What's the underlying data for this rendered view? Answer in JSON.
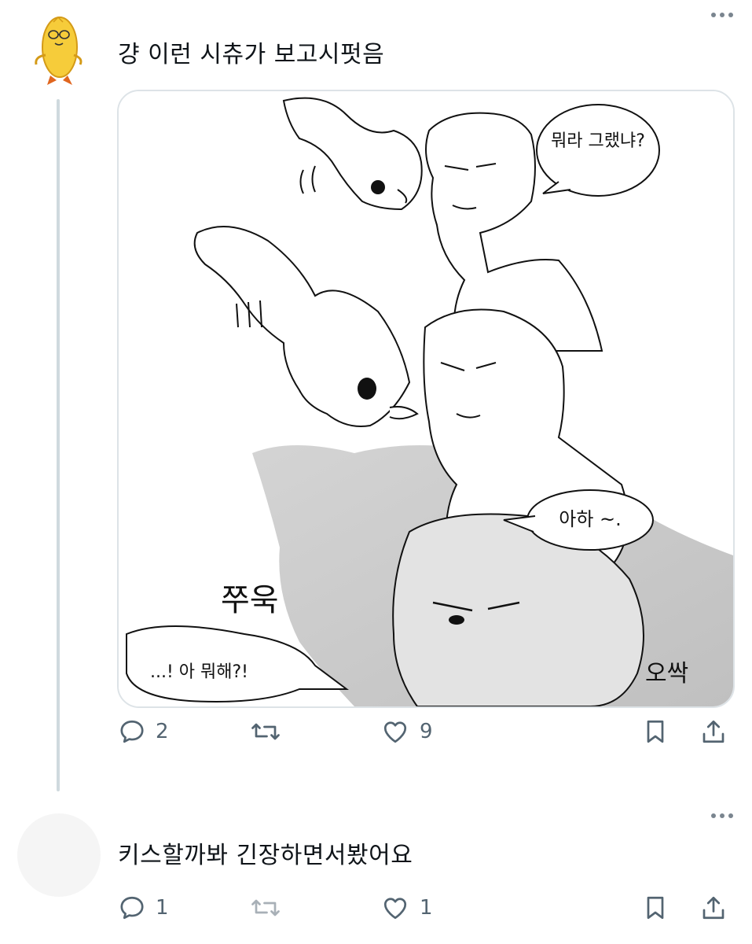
{
  "tweets": [
    {
      "text": "걍 이런 시츄가 보고시펏음",
      "illustration": {
        "bubble_top": "뭐라 그랬냐?",
        "bubble_mid": "아하 ~.",
        "sfx_left": "쭈욱",
        "shout_bottom": "...! 아 뭐해?!",
        "signature": "오싹"
      },
      "reply_count": "2",
      "like_count": "9",
      "icons": [
        "reply-icon",
        "retweet-icon",
        "like-icon",
        "bookmark-icon",
        "share-icon"
      ]
    },
    {
      "text": "키스할까봐 긴장하면서봤어요",
      "reply_count": "1",
      "like_count": "1",
      "icons": [
        "reply-icon",
        "retweet-icon",
        "like-icon",
        "bookmark-icon",
        "share-icon"
      ]
    }
  ],
  "colors": {
    "icon": "#536471",
    "thread_line": "#cfd9de",
    "border": "#dde3e7"
  }
}
